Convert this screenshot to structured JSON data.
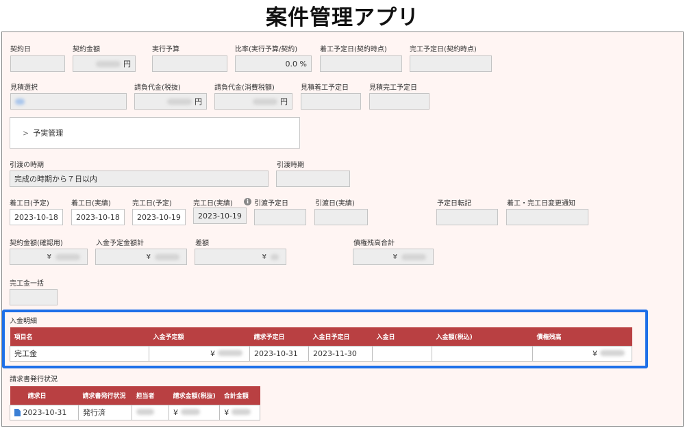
{
  "app": {
    "title": "案件管理アプリ"
  },
  "contract": {
    "date_label": "契約日",
    "amount_label": "契約金額",
    "amount_unit": "円",
    "budget_label": "実行予算",
    "ratio_label": "比率(実行予算/契約)",
    "ratio_value": "0.0 %",
    "start_plan_label": "着工予定日(契約時点)",
    "finish_plan_label": "完工予定日(契約時点)"
  },
  "estimate": {
    "select_label": "見積選択",
    "sub_ex_label": "請負代金(税抜)",
    "sub_ex_unit": "円",
    "sub_tax_label": "請負代金(消費税額)",
    "sub_tax_unit": "円",
    "est_start_label": "見積着工予定日",
    "est_finish_label": "見積完工予定日"
  },
  "budget_section": {
    "label": "予実管理"
  },
  "delivery": {
    "timing_label": "引渡の時期",
    "timing_value": "完成の時期から７日以内",
    "period_label": "引渡時期"
  },
  "schedule": {
    "start_plan_label": "着工日(予定)",
    "start_plan_value": "2023-10-18",
    "start_actual_label": "着工日(実績)",
    "start_actual_value": "2023-10-18",
    "finish_plan_label": "完工日(予定)",
    "finish_plan_value": "2023-10-19",
    "finish_actual_label": "完工日(実績)",
    "finish_actual_value": "2023-10-19",
    "info_icon": "i",
    "delivery_plan_label": "引渡予定日",
    "delivery_actual_label": "引渡日(実績)",
    "transfer_label": "予定日転記",
    "notice_label": "着工・完工日変更通知"
  },
  "totals": {
    "confirm_label": "契約金額(確認用)",
    "planned_total_label": "入金予定金額計",
    "diff_label": "差額",
    "balance_label": "債権残高合計",
    "yen": "¥"
  },
  "lump": {
    "label": "完工金一括"
  },
  "payment_details": {
    "title": "入金明細",
    "headers": [
      "項目名",
      "入金予定額",
      "請求予定日",
      "入金日予定日",
      "入金日",
      "入金額(税込)",
      "債権残高"
    ],
    "row": {
      "item": "完工金",
      "yen1": "¥",
      "bill_plan": "2023-10-31",
      "pay_plan": "2023-11-30",
      "yen2": "¥"
    }
  },
  "invoice_status": {
    "title": "請求書発行状況",
    "headers": [
      "請求日",
      "請求書発行状況",
      "担当者",
      "請求金額(税抜)",
      "合計金額"
    ],
    "row": {
      "date": "2023-10-31",
      "status": "発行済",
      "yen1": "¥",
      "yen2": "¥"
    }
  },
  "colors": {
    "accent": "#b94042",
    "highlight": "#1e6fe8",
    "panel_bg": "#fff5f3"
  }
}
